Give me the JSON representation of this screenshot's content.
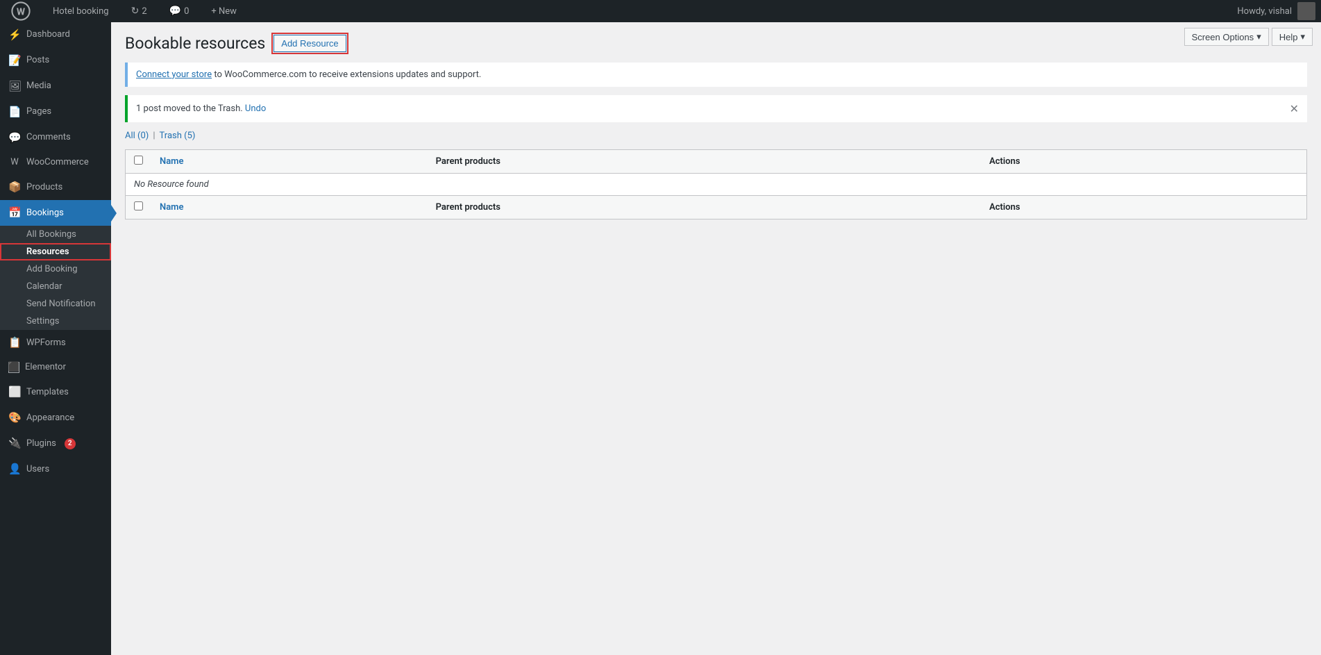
{
  "adminbar": {
    "site_name": "Hotel booking",
    "revisions_count": "2",
    "comments_count": "0",
    "new_label": "+ New",
    "howdy_label": "Howdy, vishal"
  },
  "screen_options": {
    "label": "Screen Options",
    "help_label": "Help"
  },
  "sidebar": {
    "items": [
      {
        "id": "dashboard",
        "label": "Dashboard",
        "icon": "⚡"
      },
      {
        "id": "posts",
        "label": "Posts",
        "icon": "📝"
      },
      {
        "id": "media",
        "label": "Media",
        "icon": "🖼"
      },
      {
        "id": "pages",
        "label": "Pages",
        "icon": "📄"
      },
      {
        "id": "comments",
        "label": "Comments",
        "icon": "💬"
      },
      {
        "id": "woocommerce",
        "label": "WooCommerce",
        "icon": "🛒"
      },
      {
        "id": "products",
        "label": "Products",
        "icon": "📦"
      },
      {
        "id": "bookings",
        "label": "Bookings",
        "icon": "📅"
      },
      {
        "id": "wpforms",
        "label": "WPForms",
        "icon": "📋"
      },
      {
        "id": "elementor",
        "label": "Elementor",
        "icon": "⬛"
      },
      {
        "id": "templates",
        "label": "Templates",
        "icon": "⬜"
      },
      {
        "id": "appearance",
        "label": "Appearance",
        "icon": "🎨"
      },
      {
        "id": "plugins",
        "label": "Plugins",
        "icon": "🔌",
        "badge": "2"
      },
      {
        "id": "users",
        "label": "Users",
        "icon": "👤"
      }
    ],
    "bookings_submenu": [
      {
        "id": "all-bookings",
        "label": "All Bookings"
      },
      {
        "id": "resources",
        "label": "Resources",
        "highlighted": true
      },
      {
        "id": "add-booking",
        "label": "Add Booking"
      },
      {
        "id": "calendar",
        "label": "Calendar"
      },
      {
        "id": "send-notification",
        "label": "Send Notification"
      },
      {
        "id": "settings",
        "label": "Settings"
      }
    ]
  },
  "page": {
    "title": "Bookable resources",
    "add_resource_label": "Add Resource"
  },
  "notices": {
    "store_notice": {
      "link_text": "Connect your store",
      "text": " to WooCommerce.com to receive extensions updates and support."
    },
    "trash_notice": {
      "text": "1 post moved to the Trash. ",
      "undo_text": "Undo"
    }
  },
  "filters": {
    "all_label": "All",
    "all_count": "(0)",
    "trash_label": "Trash",
    "trash_count": "(5)"
  },
  "table": {
    "columns": [
      {
        "id": "name",
        "label": "Name"
      },
      {
        "id": "parent_products",
        "label": "Parent products"
      },
      {
        "id": "actions",
        "label": "Actions"
      }
    ],
    "empty_message": "No Resource found",
    "rows": []
  }
}
